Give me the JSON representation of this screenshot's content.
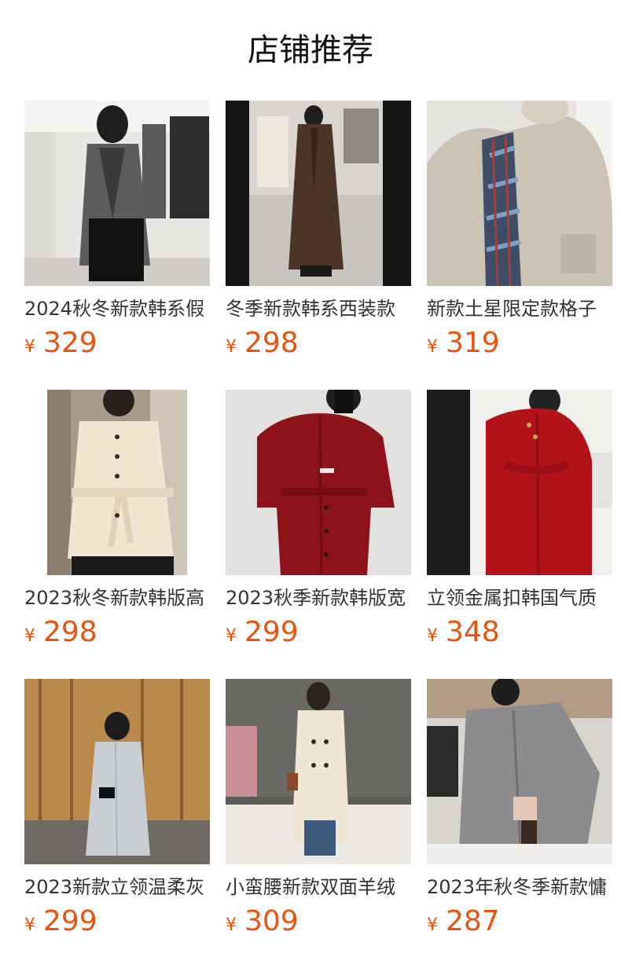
{
  "section": {
    "title": "店铺推荐"
  },
  "currency_symbol": "¥",
  "accent_color": "#e8530e",
  "products": [
    {
      "name": "2024秋冬新款韩系假",
      "price": "329",
      "image": "gray-long-coat-photo"
    },
    {
      "name": "冬季新款韩系西装款",
      "price": "298",
      "image": "brown-long-coat-photo"
    },
    {
      "name": "新款土星限定款格子",
      "price": "319",
      "image": "beige-coat-plaid-scarf-photo"
    },
    {
      "name": "2023秋冬新款韩版高",
      "price": "298",
      "image": "cream-belted-coat-photo"
    },
    {
      "name": "2023秋季新款韩版宽",
      "price": "299",
      "image": "burgundy-belted-coat-photo"
    },
    {
      "name": "立领金属扣韩国气质",
      "price": "348",
      "image": "red-standcollar-coat-photo"
    },
    {
      "name": "2023新款立领温柔灰",
      "price": "299",
      "image": "light-gray-coat-photo"
    },
    {
      "name": "小蛮腰新款双面羊绒",
      "price": "309",
      "image": "ivory-double-breasted-coat-photo"
    },
    {
      "name": "2023年秋冬季新款慵",
      "price": "287",
      "image": "gray-oversized-coat-photo"
    }
  ]
}
